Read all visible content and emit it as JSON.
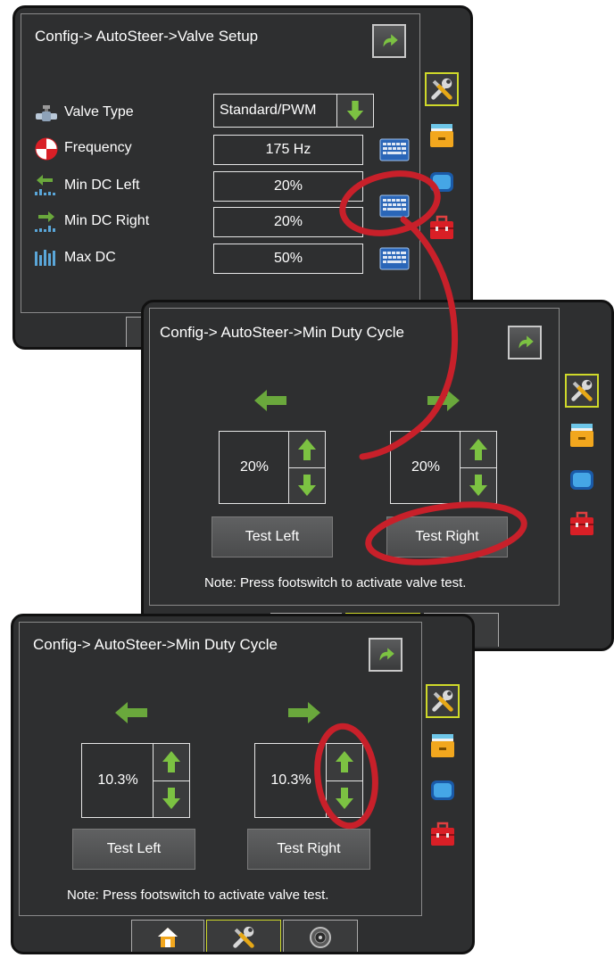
{
  "screen1": {
    "title": "Config-> AutoSteer->Valve Setup",
    "rows": [
      {
        "label": "Valve Type",
        "value": "Standard/PWM"
      },
      {
        "label": "Frequency",
        "value": "175 Hz"
      },
      {
        "label": "Min DC Left",
        "value": "20%"
      },
      {
        "label": "Min DC Right",
        "value": "20%"
      },
      {
        "label": "Max DC",
        "value": "50%"
      }
    ]
  },
  "screen2": {
    "title": "Config-> AutoSteer->Min Duty Cycle",
    "left_value": "20%",
    "right_value": "20%",
    "test_left": "Test Left",
    "test_right": "Test Right",
    "note": "Note: Press footswitch to activate valve test."
  },
  "screen3": {
    "title": "Config-> AutoSteer->Min Duty Cycle",
    "left_value": "10.3%",
    "right_value": "10.3%",
    "test_left": "Test Left",
    "test_right": "Test Right",
    "note": "Note: Press footswitch to activate valve test."
  },
  "icons": {
    "back": "return-arrow-icon",
    "side_tabs": [
      "tools-icon",
      "cabinet-icon",
      "console-icon",
      "toolbox-icon"
    ],
    "bottom_tabs": [
      "home-icon",
      "tools-icon",
      "gauge-icon"
    ]
  },
  "colors": {
    "panel": "#2e2f30",
    "accent": "#cfd92a",
    "arrow_green": "#6aa83c",
    "highlight_red": "#c8202a"
  }
}
